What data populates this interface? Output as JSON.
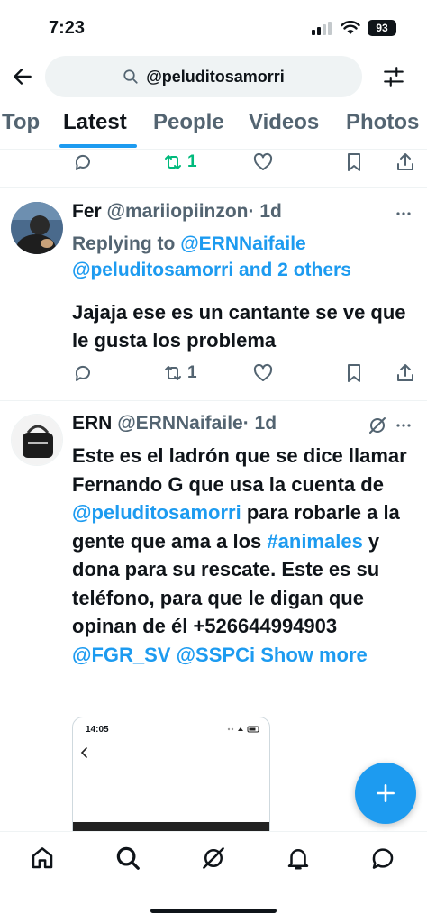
{
  "status_bar": {
    "time": "7:23",
    "battery": "93"
  },
  "search": {
    "query": "@peluditosamorri"
  },
  "tabs": [
    {
      "label": "Top"
    },
    {
      "label": "Latest"
    },
    {
      "label": "People"
    },
    {
      "label": "Videos"
    },
    {
      "label": "Photos"
    }
  ],
  "prev_tweet_actions": {
    "retweet_count": "1"
  },
  "tweets": [
    {
      "name": "Fer",
      "handle": "@mariiopiinzon",
      "time": "· 1d",
      "replying_label": "Replying to",
      "replying_user": "@ERNNaifaile",
      "replying_user2": "@peluditosamorri",
      "replying_others": "and 2 others",
      "text": "Jajaja ese es un cantante se ve que le gusta los problema",
      "retweet_count": "1"
    },
    {
      "name": "ERN",
      "handle": "@ERNNaifaile",
      "time": "· 1d",
      "text_part1": "Este es el ladrón que se dice llamar Fernando G que usa la cuenta de ",
      "mention1": "@peluditosamorri",
      "text_part2": " para robarle a la gente que ama a los ",
      "hashtag": "#animales",
      "text_part3": " y dona para su rescate. Este es su teléfono, para que le digan que opinan de él  +526644994903 ",
      "mention2": "@FGR_SV",
      "mention3": "@SSPCi",
      "show_more": "Show more",
      "image_time": "14:05"
    }
  ],
  "colors": {
    "accent": "#1d9bf0",
    "retweet_green": "#00ba7c",
    "secondary_text": "#536471"
  }
}
